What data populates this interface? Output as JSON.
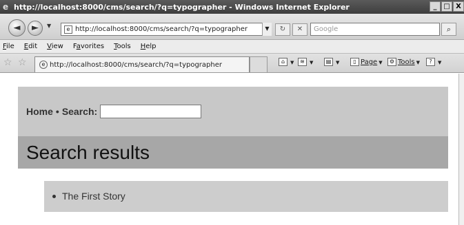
{
  "window": {
    "title": "http://localhost:8000/cms/search/?q=typographer - Windows Internet Explorer",
    "controls": [
      "_",
      "□",
      "X"
    ]
  },
  "address_bar": {
    "url": "http://localhost:8000/cms/search/?q=typographer",
    "search_placeholder": "Google"
  },
  "menu": {
    "items": [
      {
        "key": "F",
        "rest": "ile"
      },
      {
        "key": "E",
        "rest": "dit"
      },
      {
        "key": "V",
        "rest": "iew"
      },
      {
        "key": "a",
        "pre": "F",
        "rest": "vorites"
      },
      {
        "key": "T",
        "rest": "ools"
      },
      {
        "key": "H",
        "rest": "elp"
      }
    ]
  },
  "tab": {
    "label": "http://localhost:8000/cms/search/?q=typographer"
  },
  "command_bar": {
    "page_label": "Page",
    "tools_label": "Tools"
  },
  "page": {
    "breadcrumb_home": "Home",
    "breadcrumb_sep": "•",
    "search_label": "Search:",
    "search_value": "",
    "heading": "Search results",
    "results": [
      "The First Story"
    ]
  }
}
